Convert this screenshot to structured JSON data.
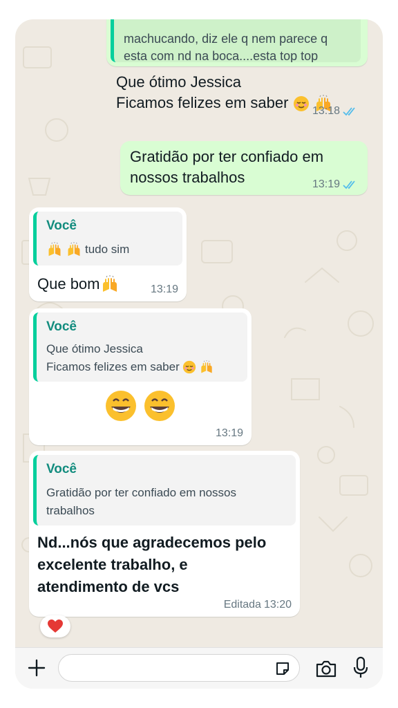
{
  "colors": {
    "outgoing_bubble": "#d9fdd3",
    "incoming_bubble": "#ffffff",
    "quote_bar": "#06cf9c",
    "quote_author": "#128c7e",
    "read_ticks": "#53bdeb",
    "chat_background": "#efeae2"
  },
  "messages": [
    {
      "direction": "outgoing",
      "partial_lines": [
        "machucando, diz ele q nem parece q",
        "esta com nd na boca....esta top top"
      ]
    },
    {
      "direction": "outgoing",
      "lines": [
        "Que ótimo Jessica",
        "Ficamos felizes em saber"
      ],
      "line2_emojis": [
        "relieved-face",
        "raising-hands"
      ],
      "time": "13:18",
      "status": "read"
    },
    {
      "direction": "outgoing",
      "lines": [
        "Gratidão por ter confiado em",
        "nossos trabalhos"
      ],
      "time": "13:19",
      "status": "read"
    },
    {
      "direction": "incoming",
      "quote": {
        "author": "Você",
        "emojis": [
          "raising-hands",
          "raising-hands"
        ],
        "text": "tudo sim"
      },
      "text": "Que bom",
      "emojis": [
        "raising-hands"
      ],
      "time": "13:19"
    },
    {
      "direction": "incoming",
      "quote": {
        "author": "Você",
        "lines": [
          "Que ótimo Jessica",
          "Ficamos felizes em saber"
        ],
        "emojis": [
          "relieved-face",
          "raising-hands"
        ]
      },
      "emojis": [
        "grinning-face",
        "grinning-face"
      ],
      "time": "13:19"
    },
    {
      "direction": "incoming",
      "quote": {
        "author": "Você",
        "lines": [
          "Gratidão por ter confiado em nossos",
          "trabalhos"
        ]
      },
      "lines": [
        "Nd...nós que agradecemos pelo",
        "excelente trabalho,  e",
        "atendimento de vcs"
      ],
      "edited_label": "Editada",
      "time": "13:20",
      "reaction": "red-heart"
    }
  ],
  "composer": {
    "attach_icon": "plus-icon",
    "sticker_icon": "sticker-icon",
    "camera_icon": "camera-icon",
    "mic_icon": "microphone-icon"
  }
}
